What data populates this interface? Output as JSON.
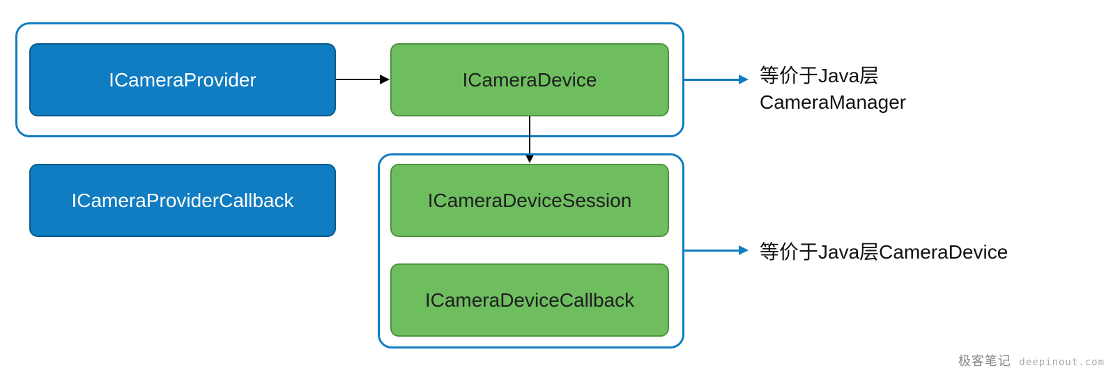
{
  "boxes": {
    "provider": "ICameraProvider",
    "device": "ICameraDevice",
    "providerCallback": "ICameraProviderCallback",
    "deviceSession": "ICameraDeviceSession",
    "deviceCallback": "ICameraDeviceCallback"
  },
  "annotations": {
    "topLine1": "等价于Java层",
    "topLine2": "CameraManager",
    "bottom": "等价于Java层CameraDevice"
  },
  "watermark": {
    "label": "极客笔记",
    "url": "deepinout.com"
  },
  "colors": {
    "blue": "#107cc1",
    "green": "#6ebe5f"
  }
}
